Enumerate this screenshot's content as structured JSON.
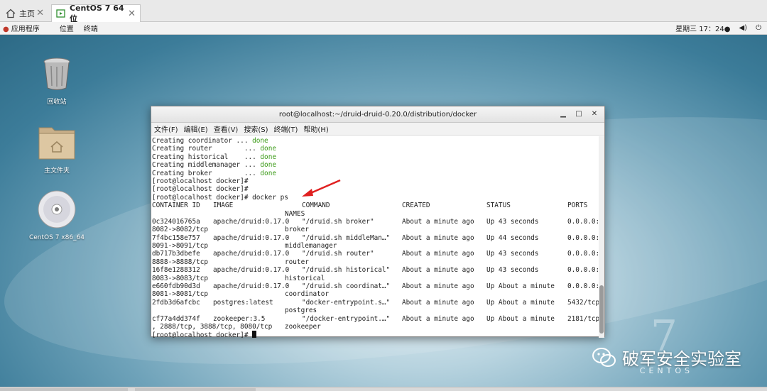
{
  "tabs": [
    {
      "label": "主页"
    },
    {
      "label": "CentOS 7 64 位"
    }
  ],
  "panel": {
    "applications": "应用程序",
    "places": "位置",
    "terminal": "终端",
    "clock": "星期三 17：24●"
  },
  "desktop": {
    "icons": [
      {
        "label": "回收站",
        "icon": "trash-icon"
      },
      {
        "label": "主文件夹",
        "icon": "home-folder-icon"
      },
      {
        "label": "CentOS 7 x86_64",
        "icon": "disc-icon"
      }
    ]
  },
  "terminal": {
    "title": "root@localhost:~/druid-druid-0.20.0/distribution/docker",
    "menu": [
      "文件(F)",
      "编辑(E)",
      "查看(V)",
      "搜索(S)",
      "终端(T)",
      "帮助(H)"
    ],
    "done_lines": [
      {
        "text": "Creating coordinator ... ",
        "status": "done"
      },
      {
        "text": "Creating router        ... ",
        "status": "done"
      },
      {
        "text": "Creating historical    ... ",
        "status": "done"
      },
      {
        "text": "Creating middlemanager ... ",
        "status": "done"
      },
      {
        "text": "Creating broker        ... ",
        "status": "done"
      }
    ],
    "prompt_lines": [
      "[root@localhost docker]# ",
      "[root@localhost docker]# ",
      "[root@localhost docker]# docker ps"
    ],
    "headers": {
      "container_id": "CONTAINER ID",
      "image": "IMAGE",
      "command": "COMMAND",
      "created": "CREATED",
      "status": "STATUS",
      "ports": "PORTS",
      "names": "NAMES"
    },
    "rows": [
      {
        "id": "0c324016765a",
        "image": "apache/druid:0.17.0",
        "command": "\"/druid.sh broker\"",
        "created": "About a minute ago",
        "status": "Up 43 seconds",
        "ports": "0.0.0.0:",
        "ports_cont": "8082->8082/tcp",
        "name": "broker"
      },
      {
        "id": "7f4bc158e757",
        "image": "apache/druid:0.17.0",
        "command": "\"/druid.sh middleMan…\"",
        "created": "About a minute ago",
        "status": "Up 44 seconds",
        "ports": "0.0.0.0:",
        "ports_cont": "8091->8091/tcp",
        "name": "middlemanager"
      },
      {
        "id": "db717b3dbefe",
        "image": "apache/druid:0.17.0",
        "command": "\"/druid.sh router\"",
        "created": "About a minute ago",
        "status": "Up 43 seconds",
        "ports": "0.0.0.0:",
        "ports_cont": "8888->8888/tcp",
        "name": "router"
      },
      {
        "id": "16f8e1288312",
        "image": "apache/druid:0.17.0",
        "command": "\"/druid.sh historical\"",
        "created": "About a minute ago",
        "status": "Up 43 seconds",
        "ports": "0.0.0.0:",
        "ports_cont": "8083->8083/tcp",
        "name": "historical"
      },
      {
        "id": "e660fdb90d3d",
        "image": "apache/druid:0.17.0",
        "command": "\"/druid.sh coordinat…\"",
        "created": "About a minute ago",
        "status": "Up About a minute",
        "ports": "0.0.0.0:",
        "ports_cont": "8081->8081/tcp",
        "name": "coordinator"
      },
      {
        "id": "2fdb3d6afcbc",
        "image": "postgres:latest",
        "command": "\"docker-entrypoint.s…\"",
        "created": "About a minute ago",
        "status": "Up About a minute",
        "ports": "5432/tcp",
        "ports_cont": "",
        "name": "postgres"
      },
      {
        "id": "cf77a4dd374f",
        "image": "zookeeper:3.5",
        "command": "\"/docker-entrypoint.…\"",
        "created": "About a minute ago",
        "status": "Up About a minute",
        "ports": "2181/tcp",
        "ports_cont": ", 2888/tcp, 3888/tcp, 8080/tcp",
        "name": "zookeeper"
      }
    ],
    "final_prompt": "[root@localhost docker]# "
  },
  "watermark": {
    "text": "破军安全实验室",
    "brand": "CENTOS",
    "seven": "7"
  },
  "colors": {
    "done_green": "#3a9a16",
    "arrow_red": "#e02020",
    "desktop_blue": "#3c7c99"
  }
}
